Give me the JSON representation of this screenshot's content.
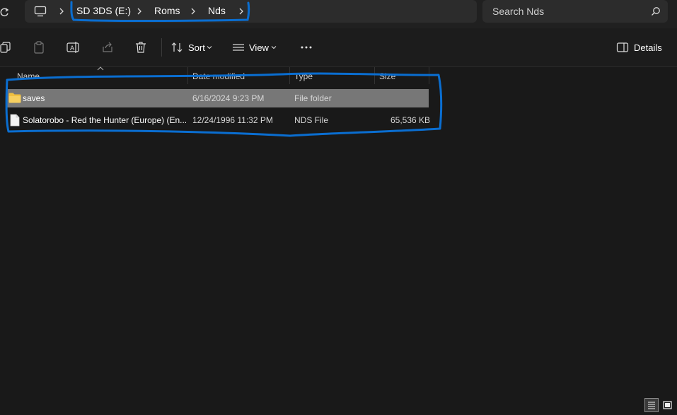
{
  "breadcrumb": {
    "items": [
      {
        "label": "SD 3DS (E:)"
      },
      {
        "label": "Roms"
      },
      {
        "label": "Nds"
      }
    ]
  },
  "search": {
    "placeholder": "Search Nds"
  },
  "toolbar": {
    "sort_label": "Sort",
    "view_label": "View",
    "details_label": "Details"
  },
  "columns": {
    "name": "Name",
    "date": "Date modified",
    "type": "Type",
    "size": "Size"
  },
  "files": [
    {
      "name": "saves",
      "date": "6/16/2024 9:23 PM",
      "type": "File folder",
      "size": "",
      "icon": "folder-icon",
      "selected": true
    },
    {
      "name": "Solatorobo - Red the Hunter (Europe) (En...",
      "date": "12/24/1996 11:32 PM",
      "type": "NDS File",
      "size": "65,536 KB",
      "icon": "file-icon",
      "selected": false
    }
  ],
  "colors": {
    "annotation": "#0a6ed1",
    "selected_row": "#777777",
    "folder": "#f0c040"
  }
}
